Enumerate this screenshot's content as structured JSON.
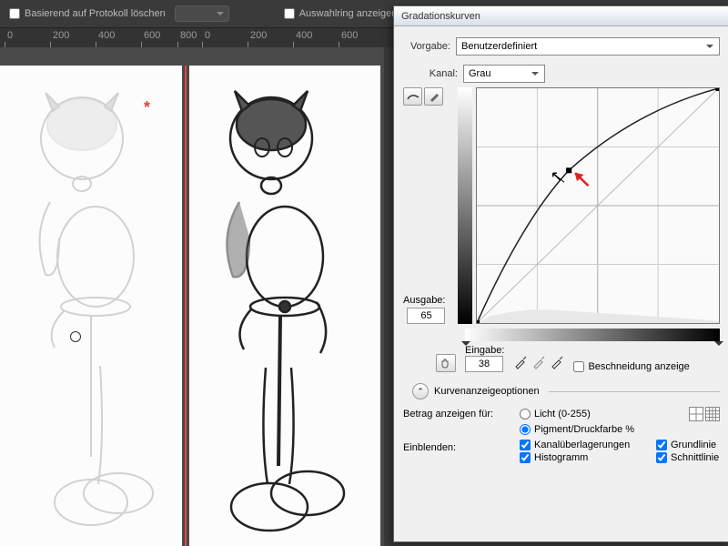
{
  "toolbar": {
    "delete_based_on_log": "Basierend auf Protokoll löschen",
    "show_selection_ring": "Auswahlring anzeigen"
  },
  "ruler": {
    "ticks": [
      "0",
      "200",
      "400",
      "600",
      "800",
      "0",
      "200",
      "400",
      "600"
    ]
  },
  "canvas": {
    "asterisk": "*"
  },
  "dialog": {
    "title": "Gradationskurven",
    "preset_label": "Vorgabe:",
    "preset_value": "Benutzerdefiniert",
    "channel_label": "Kanal:",
    "channel_value": "Grau",
    "output_label": "Ausgabe:",
    "output_value": "65",
    "input_label": "Eingabe:",
    "input_value": "38",
    "clipping_label": "Beschneidung anzeige",
    "curve_options": "Kurvenanzeigeoptionen",
    "amount_label": "Betrag anzeigen für:",
    "radio_light": "Licht (0-255)",
    "radio_pigment": "Pigment/Druckfarbe %",
    "show_label": "Einblenden:",
    "cb_channel_overlay": "Kanalüberlagerungen",
    "cb_baseline": "Grundlinie",
    "cb_histogram": "Histogramm",
    "cb_intersection": "Schnittlinie"
  },
  "chart_data": {
    "type": "line",
    "title": "Gradationskurve",
    "xlabel": "Eingabe",
    "ylabel": "Ausgabe",
    "xlim": [
      0,
      100
    ],
    "ylim": [
      0,
      100
    ],
    "series": [
      {
        "name": "Grau",
        "x": [
          0,
          38,
          100
        ],
        "y": [
          0,
          65,
          100
        ]
      }
    ],
    "control_point": {
      "input": 38,
      "output": 65
    },
    "diagonal": true,
    "grid": "4x4"
  }
}
